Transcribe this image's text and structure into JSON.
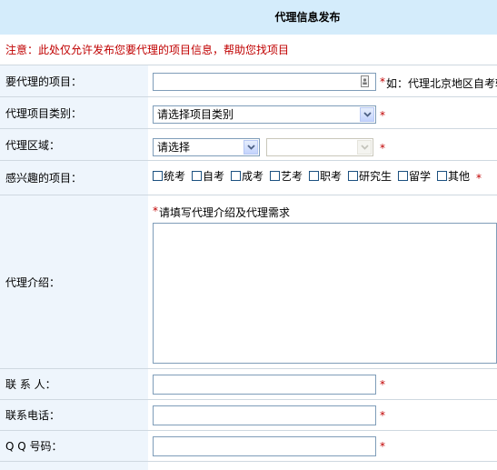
{
  "header": {
    "title": "代理信息发布"
  },
  "notice": "注意：此处仅允许发布您要代理的项目信息，帮助您找项目",
  "form": {
    "project": {
      "label": "要代理的项目：",
      "star": "*",
      "hint": "如：代理北京地区自考辅"
    },
    "category": {
      "label": "代理项目类别：",
      "value": "请选择项目类别",
      "star": "*"
    },
    "region": {
      "label": "代理区域：",
      "value": "请选择",
      "value2": "",
      "star": "*"
    },
    "interests": {
      "label": "感兴趣的项目：",
      "options": [
        "统考",
        "自考",
        "成考",
        "艺考",
        "职考",
        "研究生",
        "留学",
        "其他"
      ],
      "star": "*"
    },
    "intro": {
      "label": "代理介绍：",
      "star": "*",
      "hint": "请填写代理介绍及代理需求"
    },
    "contact": {
      "label": "联 系 人：",
      "star": "*"
    },
    "phone": {
      "label": "联系电话：",
      "star": "*"
    },
    "qq": {
      "label": "Q Q 号码：",
      "star": "*"
    }
  },
  "colors": {
    "header_bg": "#d4ecfb",
    "label_bg": "#eef5fc",
    "notice": "#c00000",
    "star": "#c00000"
  },
  "icons": {
    "contact_card": "contact-card-icon",
    "dropdown": "chevron-down-icon"
  }
}
